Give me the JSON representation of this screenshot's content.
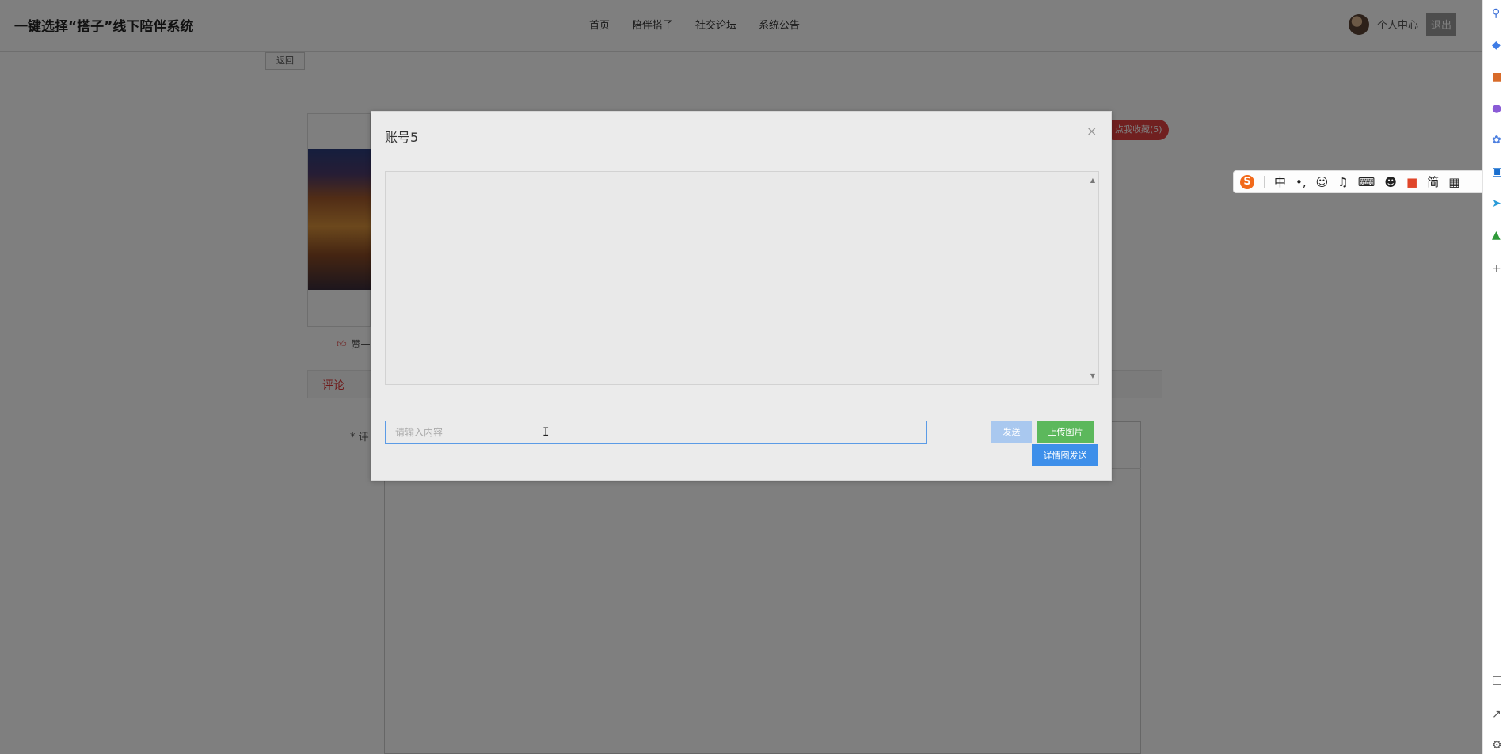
{
  "site": {
    "title": "一键选择“搭子”线下陪伴系统"
  },
  "nav": {
    "items": [
      "首页",
      "陪伴搭子",
      "社交论坛",
      "系统公告"
    ]
  },
  "user": {
    "center_label": "个人中心",
    "logout_label": "退出"
  },
  "page": {
    "back_label": "返回",
    "collect_label": "点我收藏(5)",
    "like_label": "赞一",
    "comment_tab": "评论",
    "comment_field_label": "* 评"
  },
  "modal": {
    "title": "账号5",
    "close_symbol": "×",
    "input_placeholder": "请输入内容",
    "send_label": "发送",
    "upload_label": "上传图片",
    "detail_send_label": "详情图发送"
  },
  "ime": {
    "mode": "中",
    "simplified": "简"
  },
  "colors": {
    "overlay": "rgba(0,0,0,0.5)",
    "send_disabled": "#a9c8ef",
    "upload": "#5cb85c",
    "detail_send": "#3d8fea",
    "collect": "#e04040"
  }
}
